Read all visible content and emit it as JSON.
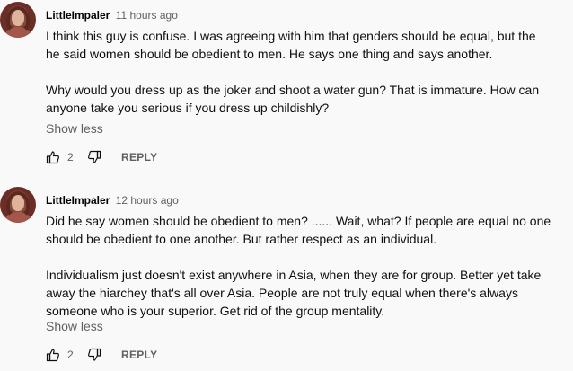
{
  "comments": [
    {
      "author": "LittleImpaler",
      "time": "11 hours ago",
      "lines": [
        "I think this guy is confuse.  I was agreeing with him that genders should be equal,  but the",
        "he said women should be obedient to men. He says one thing and says another.",
        "",
        "Why would you dress up as the joker  and shoot a water gun?  That is immature.  How can",
        "anyone take you serious if you dress up childishly?"
      ],
      "show_less": "Show less",
      "likes": "2",
      "reply_label": "REPLY"
    },
    {
      "author": "LittleImpaler",
      "time": "12 hours ago",
      "lines": [
        "Did he say women  should be obedient to men?  ...... Wait, what? If people are equal no one",
        "should be obedient to one another. But rather respect as an individual.",
        "",
        "Individualism just doesn't exist anywhere in Asia,  when they are for group.  Better yet take",
        "away the hiarchey that's all over Asia.   People are not truly equal when there's always",
        "someone who is your superior.  Get rid of the group mentality."
      ],
      "show_less": "Show less",
      "likes": "2",
      "reply_label": "REPLY"
    }
  ],
  "icons": {
    "like": "thumbs-up-icon",
    "dislike": "thumbs-down-icon"
  },
  "colors": {
    "background": "#f9f9f9",
    "secondary_text": "#606060",
    "primary_text": "#0f0f0f"
  }
}
